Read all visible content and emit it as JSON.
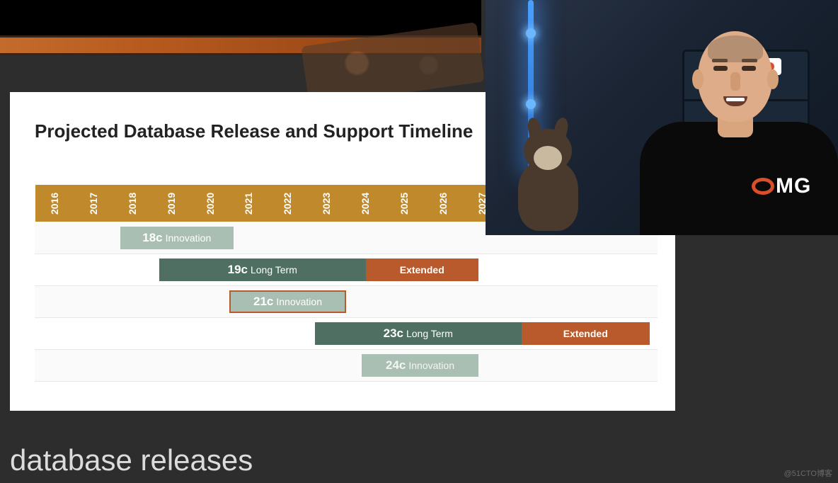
{
  "slide": {
    "title": "Projected Database Release and Support Timeline"
  },
  "chart_data": {
    "type": "gantt",
    "x_axis": {
      "years": [
        "2016",
        "2017",
        "2018",
        "2019",
        "2020",
        "2021",
        "2022",
        "2023",
        "2024",
        "2025",
        "2026",
        "2027"
      ],
      "start": 2016,
      "end": 2032,
      "visible_end": 2032
    },
    "releases": [
      {
        "version": "18c",
        "type": "Innovation",
        "start": 2018.2,
        "end": 2021.1,
        "color": "#a9bfb3"
      },
      {
        "version": "19c",
        "type": "Long Term",
        "start": 2019.2,
        "end": 2024.5,
        "extended_end": 2027.4,
        "color": "#4e6f61",
        "extended_color": "#b85a2c"
      },
      {
        "version": "21c",
        "type": "Innovation",
        "start": 2021.0,
        "end": 2024.0,
        "color": "#a9bfb3",
        "highlighted": true
      },
      {
        "version": "23c",
        "type": "Long Term",
        "start": 2023.2,
        "end": 2028.5,
        "extended_end": 2031.8,
        "color": "#4e6f61",
        "extended_color": "#b85a2c"
      },
      {
        "version": "24c",
        "type": "Innovation",
        "start": 2024.4,
        "end": 2027.4,
        "color": "#a9bfb3",
        "faded": true
      }
    ],
    "labels": {
      "extended": "Extended"
    }
  },
  "caption": "database releases",
  "watermark": "@51CTO博客",
  "presenter": {
    "shirt_text": "MG",
    "shirt_logo": "oracle-o"
  },
  "colors": {
    "year_header": "#c08a2c",
    "innovation": "#a9bfb3",
    "long_term": "#4e6f61",
    "extended": "#b85a2c",
    "background": "#2d2d2d"
  }
}
